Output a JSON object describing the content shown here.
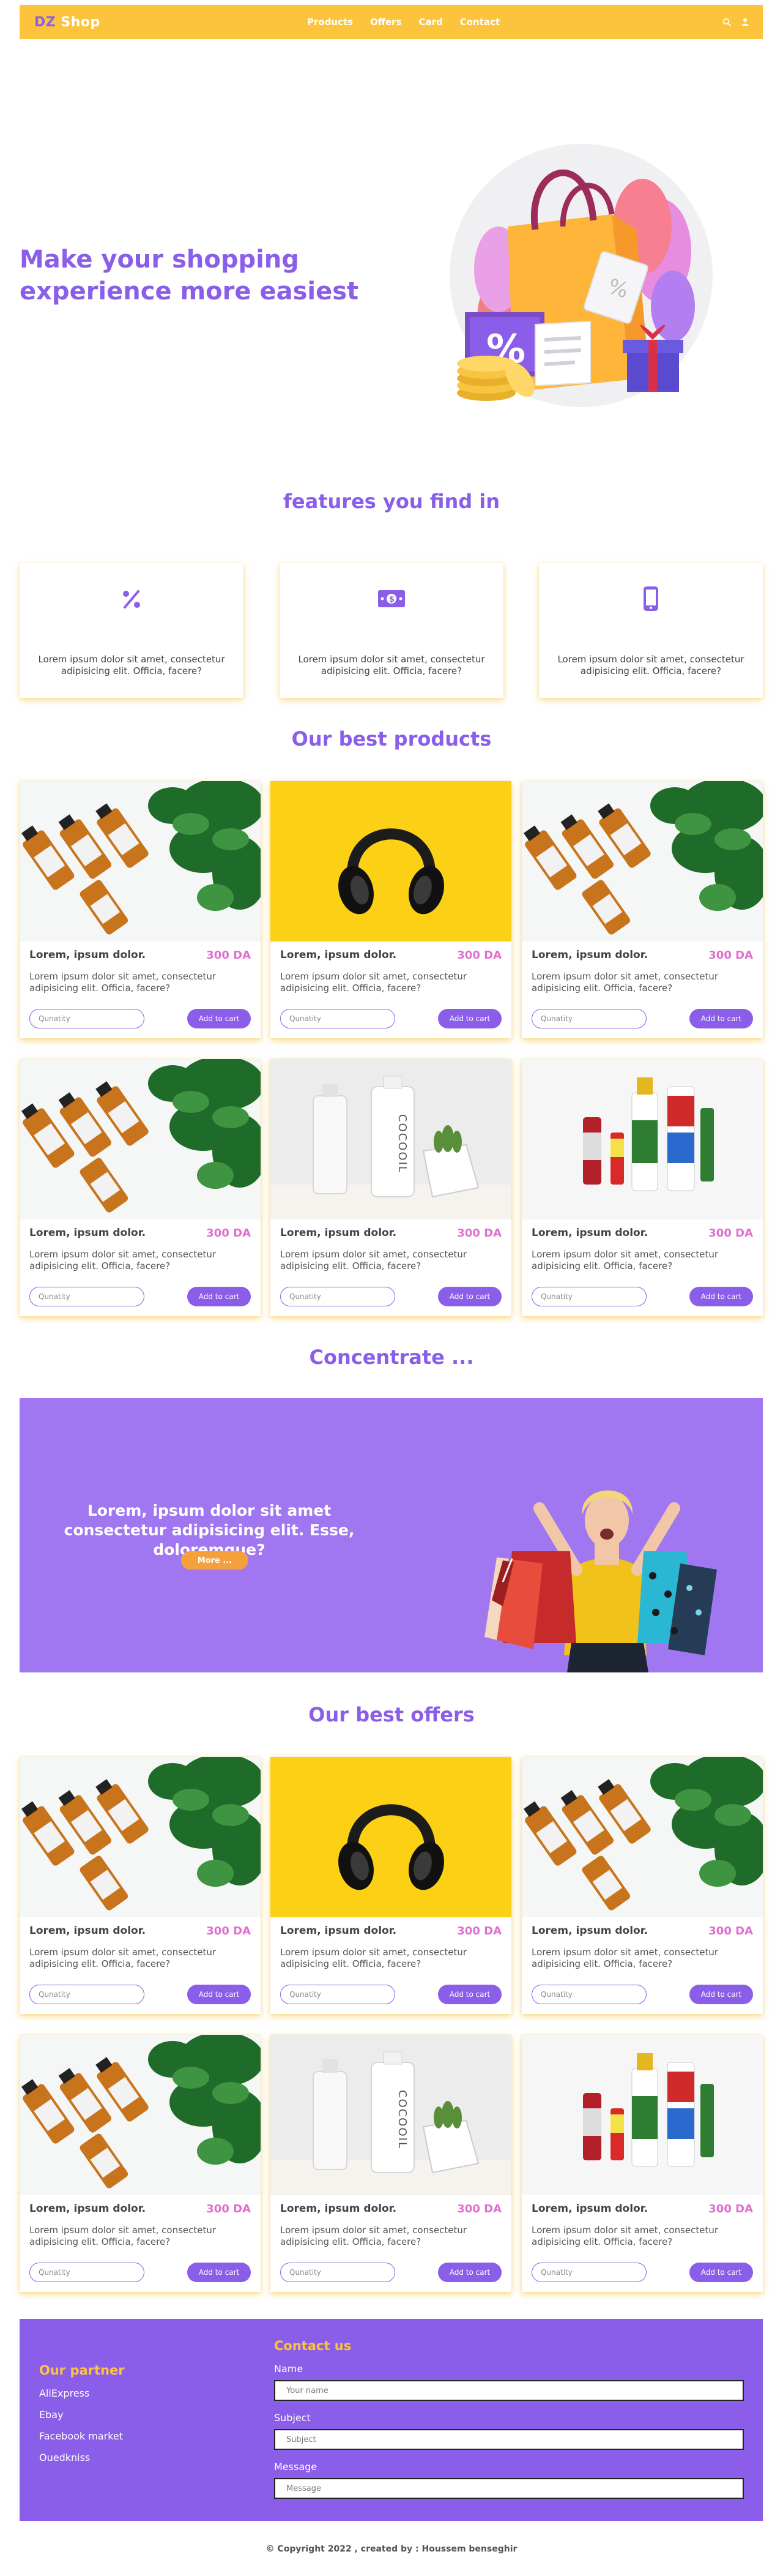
{
  "nav": {
    "logo_prefix": "DZ",
    "logo_suffix": " Shop",
    "links": [
      "Products",
      "Offers",
      "Card",
      "Contact"
    ]
  },
  "hero": {
    "title": "Make your shopping experience more easiest"
  },
  "features": {
    "title": "features you find in",
    "items": [
      {
        "icon": "percent-icon",
        "text": "Lorem ipsum dolor sit amet, consectetur adipisicing elit. Officia, facere?"
      },
      {
        "icon": "money-icon",
        "text": "Lorem ipsum dolor sit amet, consectetur adipisicing elit. Officia, facere?"
      },
      {
        "icon": "phone-icon",
        "text": "Lorem ipsum dolor sit amet, consectetur adipisicing elit. Officia, facere?"
      }
    ]
  },
  "products": {
    "title": "Our best products",
    "items": [
      {
        "image": "oils",
        "name": "Lorem, ipsum dolor.",
        "price": "300 DA",
        "desc": "Lorem ipsum dolor sit amet, consectetur adipisicing elit. Officia, facere?",
        "qty_placeholder": "Qunatity",
        "button": "Add to cart"
      },
      {
        "image": "headphones",
        "name": "Lorem, ipsum dolor.",
        "price": "300 DA",
        "desc": "Lorem ipsum dolor sit amet, consectetur adipisicing elit. Officia, facere?",
        "qty_placeholder": "Qunatity",
        "button": "Add to cart"
      },
      {
        "image": "oils",
        "name": "Lorem, ipsum dolor.",
        "price": "300 DA",
        "desc": "Lorem ipsum dolor sit amet, consectetur adipisicing elit. Officia, facere?",
        "qty_placeholder": "Qunatity",
        "button": "Add to cart"
      },
      {
        "image": "oils",
        "name": "Lorem, ipsum dolor.",
        "price": "300 DA",
        "desc": "Lorem ipsum dolor sit amet, consectetur adipisicing elit. Officia, facere?",
        "qty_placeholder": "Qunatity",
        "button": "Add to cart"
      },
      {
        "image": "cosmetics",
        "name": "Lorem, ipsum dolor.",
        "price": "300 DA",
        "desc": "Lorem ipsum dolor sit amet, consectetur adipisicing elit. Officia, facere?",
        "qty_placeholder": "Qunatity",
        "button": "Add to cart"
      },
      {
        "image": "adhesives",
        "name": "Lorem, ipsum dolor.",
        "price": "300 DA",
        "desc": "Lorem ipsum dolor sit amet, consectetur adipisicing elit. Officia, facere?",
        "qty_placeholder": "Qunatity",
        "button": "Add to cart"
      }
    ]
  },
  "promo": {
    "title": "Concentrate ...",
    "text": "Lorem, ipsum dolor sit amet consectetur adipisicing elit. Esse, doloremque?",
    "button": "More ..."
  },
  "offers": {
    "title": "Our best offers",
    "items": [
      {
        "image": "oils",
        "name": "Lorem, ipsum dolor.",
        "price": "300 DA",
        "desc": "Lorem ipsum dolor sit amet, consectetur adipisicing elit. Officia, facere?",
        "qty_placeholder": "Qunatity",
        "button": "Add to cart"
      },
      {
        "image": "headphones",
        "name": "Lorem, ipsum dolor.",
        "price": "300 DA",
        "desc": "Lorem ipsum dolor sit amet, consectetur adipisicing elit. Officia, facere?",
        "qty_placeholder": "Qunatity",
        "button": "Add to cart"
      },
      {
        "image": "oils",
        "name": "Lorem, ipsum dolor.",
        "price": "300 DA",
        "desc": "Lorem ipsum dolor sit amet, consectetur adipisicing elit. Officia, facere?",
        "qty_placeholder": "Qunatity",
        "button": "Add to cart"
      },
      {
        "image": "oils",
        "name": "Lorem, ipsum dolor.",
        "price": "300 DA",
        "desc": "Lorem ipsum dolor sit amet, consectetur adipisicing elit. Officia, facere?",
        "qty_placeholder": "Qunatity",
        "button": "Add to cart"
      },
      {
        "image": "cosmetics",
        "name": "Lorem, ipsum dolor.",
        "price": "300 DA",
        "desc": "Lorem ipsum dolor sit amet, consectetur adipisicing elit. Officia, facere?",
        "qty_placeholder": "Qunatity",
        "button": "Add to cart"
      },
      {
        "image": "adhesives",
        "name": "Lorem, ipsum dolor.",
        "price": "300 DA",
        "desc": "Lorem ipsum dolor sit amet, consectetur adipisicing elit. Officia, facere?",
        "qty_placeholder": "Qunatity",
        "button": "Add to cart"
      }
    ]
  },
  "footer": {
    "partner_title": "Our partner",
    "partners": [
      "AliExpress",
      "Ebay",
      "Facebook market",
      "Ouedkniss"
    ],
    "contact_title": "Contact us",
    "name_label": "Name",
    "name_placeholder": "Your name",
    "subject_label": "Subject",
    "subject_placeholder": "Subject",
    "message_label": "Message",
    "message_placeholder": "Message"
  },
  "copyright": "© Copyright 2022 , created by : Houssem benseghir",
  "colors": {
    "primary": "#8a5ee8",
    "accent": "#fcc43c",
    "price": "#e06fd0",
    "promo_bg": "#a077f0",
    "promo_button": "#f5a03a"
  }
}
